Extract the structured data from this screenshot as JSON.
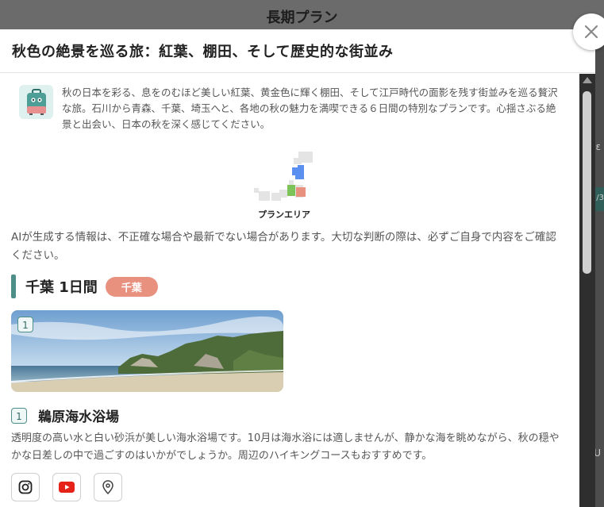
{
  "background": {
    "header_title": "長期プラン",
    "side_glyphs": [
      "ε",
      "/3",
      "U"
    ]
  },
  "modal": {
    "title": "秋色の絶景を巡る旅：紅葉、棚田、そして歴史的な街並み",
    "intro_text": "秋の日本を彩る、息をのむほど美しい紅葉、黄金色に輝く棚田、そして江戸時代の面影を残す街並みを巡る贅沢な旅。石川から青森、千葉、埼玉へと、各地の秋の魅力を満喫できる６日間の特別なプランです。心揺さぶる絶景と出会い、日本の秋を深く感じてください。",
    "map_label": "プランエリア",
    "disclaimer": "AIが生成する情報は、不正確な場合や最新でない場合があります。大切な判断の際は、必ずご自身で内容をご確認ください。",
    "day": {
      "title": "千葉 1日間",
      "prefecture_badge": "千葉"
    },
    "photo_number": "1",
    "spot": {
      "number": "1",
      "name": "鵜原海水浴場",
      "description": "透明度の高い水と白い砂浜が美しい海水浴場です。10月は海水浴には適しませんが、静かな海を眺めながら、秋の穏やかな日差しの中で過ごすのはいかがでしょうか。周辺のハイキングコースもおすすめです。"
    },
    "link_icons": [
      "instagram-icon",
      "youtube-icon",
      "map-pin-icon"
    ]
  },
  "colors": {
    "accent_teal": "#4d8f88",
    "badge_salmon": "#e8917f",
    "map_blue": "#5b8ff0",
    "map_green": "#7ec25a",
    "map_pink": "#e8917f",
    "youtube_red": "#e62117"
  }
}
